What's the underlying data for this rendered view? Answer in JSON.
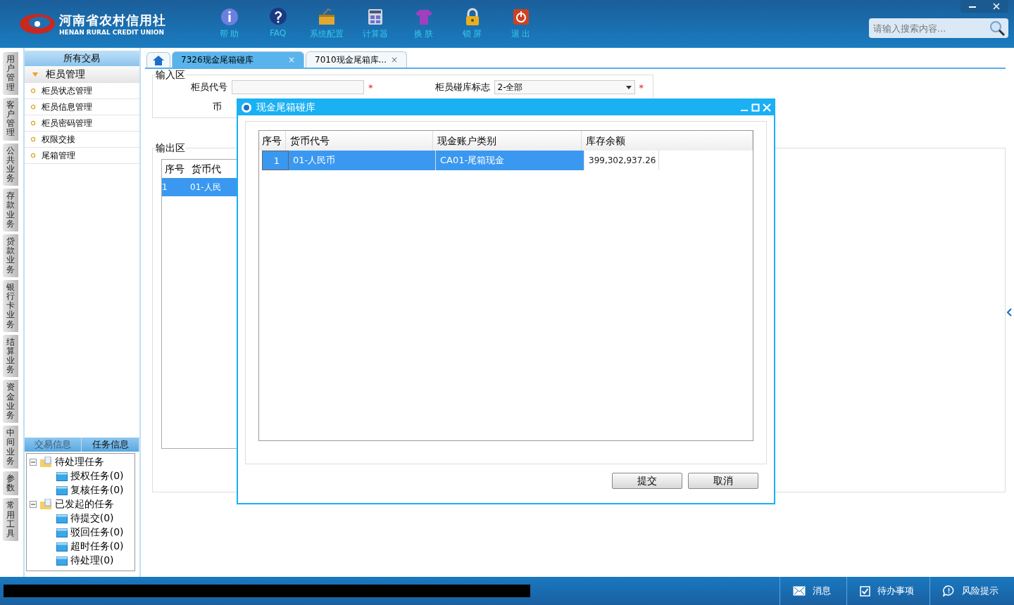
{
  "header": {
    "logo_title": "河南省农村信用社",
    "logo_subtitle": "HENAN RURAL CREDIT UNION",
    "toolbar": [
      {
        "label": "帮 助",
        "kind": "info"
      },
      {
        "label": "FAQ",
        "kind": "question"
      },
      {
        "label": "系统配置",
        "kind": "toolbox"
      },
      {
        "label": "计算器",
        "kind": "calculator"
      },
      {
        "label": "换 肤",
        "kind": "shirt"
      },
      {
        "label": "锁 屏",
        "kind": "lock"
      },
      {
        "label": "退 出",
        "kind": "power"
      }
    ],
    "search": {
      "placeholder": "请输入搜索内容..."
    }
  },
  "side_tabs": [
    "用户管理",
    "客户管理",
    "公共业务",
    "存款业务",
    "贷款业务",
    "银行卡业务",
    "结算业务",
    "资金业务",
    "中间业务",
    "参数",
    "常用工具"
  ],
  "menu": {
    "title": "所有交易",
    "group": {
      "label": "柜员管理",
      "expanded": true,
      "items": [
        "柜员状态管理",
        "柜员信息管理",
        "柜员密码管理",
        "权限交接",
        "尾箱管理"
      ]
    }
  },
  "task_panel": {
    "tabs": [
      {
        "label": "交易信息",
        "selected": false
      },
      {
        "label": "任务信息",
        "selected": true
      }
    ],
    "tree": [
      {
        "label": "待处理任务",
        "expanded": true,
        "children": [
          {
            "label": "授权任务(0)"
          },
          {
            "label": "复核任务(0)"
          }
        ]
      },
      {
        "label": "已发起的任务",
        "expanded": true,
        "children": [
          {
            "label": "待提交(0)"
          },
          {
            "label": "驳回任务(0)"
          },
          {
            "label": "超时任务(0)"
          },
          {
            "label": "待处理(0)"
          }
        ]
      }
    ]
  },
  "tabs": [
    {
      "kind": "home",
      "selected": false
    },
    {
      "kind": "page",
      "label": "7326现金尾箱碰库",
      "close": "×",
      "selected": true
    },
    {
      "kind": "page",
      "label": "7010现金尾箱库...",
      "close": "×",
      "selected": false
    }
  ],
  "input_area": {
    "title": "输入区",
    "fields": [
      {
        "label": "柜员代号",
        "kind": "text",
        "required_mark": "*"
      },
      {
        "label": "柜员碰库标志",
        "kind": "select",
        "value": "2-全部",
        "required_mark": "*"
      },
      {
        "label": "币",
        "kind": "label"
      }
    ]
  },
  "output_area": {
    "title": "输出区",
    "columns": [
      "序号",
      "货币代"
    ],
    "rows": [
      {
        "cells": [
          "1",
          "01-人民"
        ],
        "selected": true
      }
    ]
  },
  "dialog": {
    "title": "现金尾箱碰库",
    "columns": [
      "序号",
      "货币代号",
      "现金账户类别",
      "库存余额"
    ],
    "rows": [
      {
        "cells": [
          "1",
          "01-人民币",
          "CA01-尾箱现金",
          "399,302,937.26"
        ],
        "selected": true
      }
    ],
    "buttons": [
      "提交",
      "取消"
    ]
  },
  "status_bar": {
    "items": [
      {
        "label": "消息",
        "kind": "mail"
      },
      {
        "label": "待办事项",
        "kind": "check"
      },
      {
        "label": "风险提示",
        "kind": "alert"
      }
    ]
  }
}
